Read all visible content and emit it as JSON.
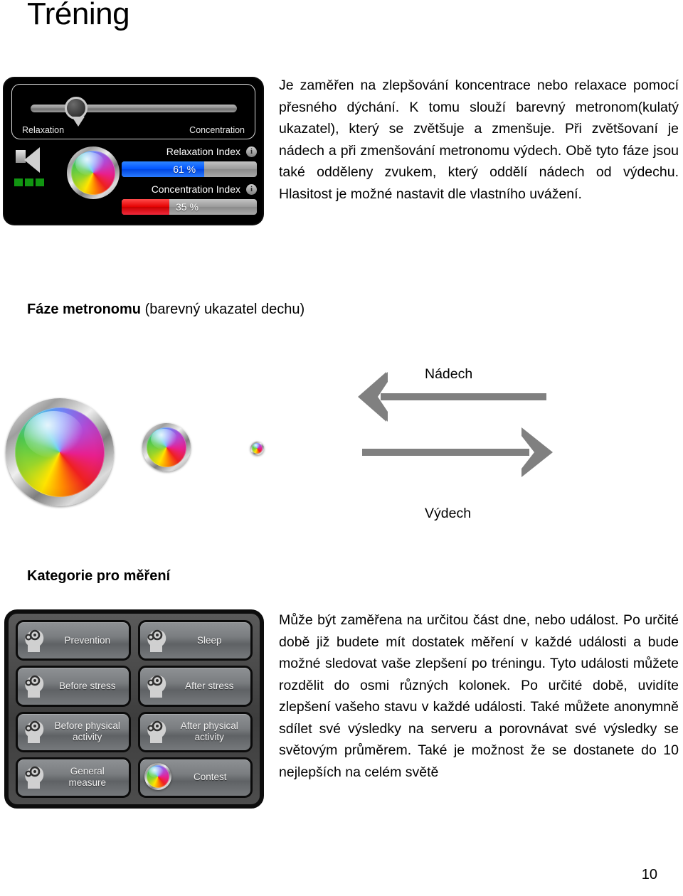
{
  "page": {
    "title": "Tréning",
    "number": "10"
  },
  "device_panel": {
    "slider": {
      "left_label": "Relaxation",
      "right_label": "Concentration",
      "position_percent": 22
    },
    "speaker": {
      "icon": "speaker-icon",
      "level_bars": 3
    },
    "metronome": {
      "icon": "color-wheel-icon"
    },
    "indices": [
      {
        "label": "Relaxation Index",
        "value": "61 %",
        "percent": 61,
        "color": "#0053ff",
        "info_icon": "info-icon"
      },
      {
        "label": "Concentration Index",
        "value": "35 %",
        "percent": 35,
        "color": "#e40000",
        "info_icon": "info-icon"
      }
    ]
  },
  "intro_paragraph": "Je zaměřen na zlepšování koncentrace nebo relaxace pomocí přesného dýchání. K tomu slouží barevný metronom(kulatý ukazatel), který se zvětšuje a zmenšuje. Při zvětšovaní je nádech a při zmenšování metronomu výdech. Obě tyto fáze jsou také odděleny zvukem, který oddělí nádech od výdechu. Hlasitost je možné nastavit dle vlastního uvážení.",
  "metronome_section": {
    "heading_bold": "Fáze metronomu",
    "heading_rest": " (barevný ukazatel dechu)",
    "inhale_label": "Nádech",
    "exhale_label": "Výdech",
    "wheel_sizes": [
      152,
      68,
      19
    ],
    "arrow_color": "#808080"
  },
  "categories_section": {
    "heading": "Kategorie pro měření",
    "buttons": [
      {
        "label": "Prevention",
        "icon": "head-gears-icon"
      },
      {
        "label": "Sleep",
        "icon": "head-gears-icon"
      },
      {
        "label": "Before stress",
        "icon": "head-gears-icon"
      },
      {
        "label": "After stress",
        "icon": "head-gears-icon"
      },
      {
        "label": "Before physical\nactivity",
        "icon": "head-gears-icon"
      },
      {
        "label": "After physical\nactivity",
        "icon": "head-gears-icon"
      },
      {
        "label": "General measure",
        "icon": "head-gears-icon"
      },
      {
        "label": "Contest",
        "icon": "color-wheel-icon"
      }
    ]
  },
  "categories_paragraph": "Může být zaměřena na určitou část dne, nebo událost. Po určité době již budete mít dostatek měření v každé události a bude možné sledovat vaše zlepšení po tréningu. Tyto události můžete rozdělit do osmi různých kolonek. Po určité době, uvidíte zlepšení vašeho stavu v každé události. Také můžete anonymně sdílet své výsledky na serveru a porovnávat své výsledky se světovým průměrem. Také je možnost že se dostanete do 10 nejlepších na celém světě"
}
